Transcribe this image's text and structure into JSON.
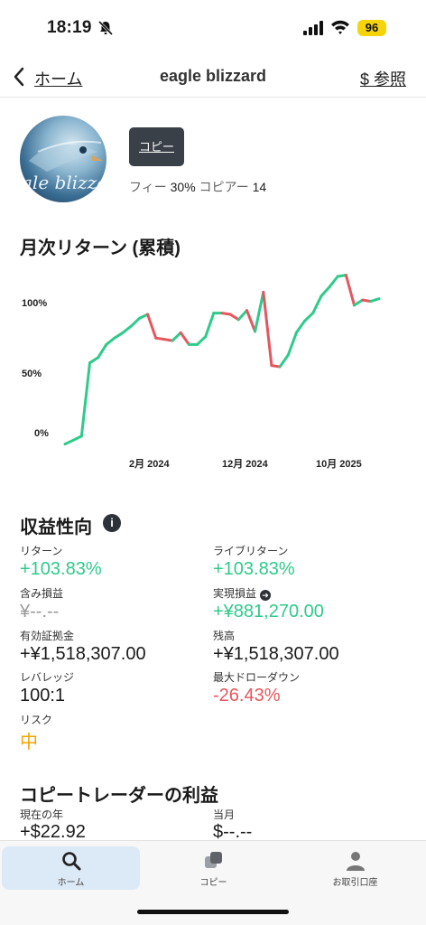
{
  "status_bar": {
    "time": "18:19",
    "battery": "96"
  },
  "nav": {
    "back_label": "ホーム",
    "title": "eagle blizzard",
    "ref_label": "$ 参照"
  },
  "profile": {
    "avatar_text": "ale blizza",
    "copy_button": "コピー",
    "fee_label": "フィー",
    "fee_value": "30%",
    "copier_label": "コピアー",
    "copier_value": "14"
  },
  "chart_section": {
    "title": "月次リターン (累積)"
  },
  "chart_data": {
    "type": "line",
    "title": "月次リターン (累積)",
    "y_ticks": [
      "0%",
      "50%",
      "100%"
    ],
    "x_ticks": [
      "2月 2024",
      "12月 2024",
      "10月 2025"
    ],
    "ylim": [
      -10,
      125
    ],
    "colors": {
      "up": "#2ecb8a",
      "down": "#e5575d"
    },
    "series": [
      {
        "values": [
          -8,
          -5,
          -2,
          54,
          58,
          68,
          73,
          77,
          82,
          88,
          91,
          73,
          72,
          71,
          77,
          68,
          68,
          74,
          92,
          92,
          91,
          87,
          94,
          78,
          108,
          52,
          51,
          60,
          77,
          86,
          92,
          105,
          112,
          120,
          121,
          98,
          102,
          101,
          103
        ]
      }
    ]
  },
  "performance": {
    "title": "収益性向",
    "info_icon": "i",
    "return_label": "リターン",
    "return_value": "+103.83%",
    "live_return_label": "ライブリターン",
    "live_return_value": "+103.83%",
    "unrealized_label": "含み損益",
    "unrealized_value": "¥--.--",
    "realized_label": "実現損益",
    "realized_value": "+¥881,270.00",
    "equity_label": "有効証拠金",
    "equity_value": "+¥1,518,307.00",
    "balance_label": "残高",
    "balance_value": "+¥1,518,307.00",
    "leverage_label": "レバレッジ",
    "leverage_value": "100:1",
    "drawdown_label": "最大ドローダウン",
    "drawdown_value": "-26.43%",
    "risk_label": "リスク",
    "risk_value": "中"
  },
  "copy_profit": {
    "title": "コピートレーダーの利益",
    "year_label": "現在の年",
    "year_value": "+$22.92",
    "month_label": "当月",
    "month_value": "$--.--"
  },
  "tabs": [
    {
      "label": "ホーム",
      "icon": "search-icon",
      "active": true
    },
    {
      "label": "コピー",
      "icon": "copy-icon",
      "active": false
    },
    {
      "label": "お取引口座",
      "icon": "person-icon",
      "active": false
    }
  ]
}
